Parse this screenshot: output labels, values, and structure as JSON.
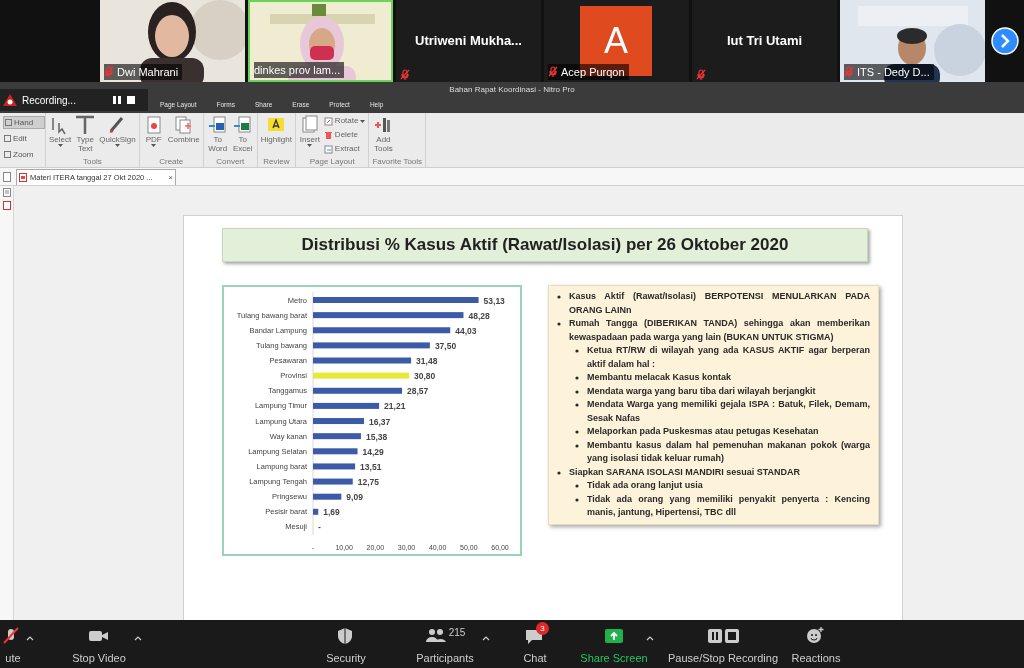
{
  "meeting": {
    "participants": [
      {
        "name": "Dwi Mahrani",
        "kind": "video",
        "muted": true
      },
      {
        "name": "dinkes prov lam...",
        "kind": "video",
        "muted": false
      },
      {
        "name": "Utriweni  Mukha...",
        "kind": "name",
        "muted": true
      },
      {
        "name": "Acep Purqon",
        "kind": "avatar",
        "letter": "A",
        "muted": true
      },
      {
        "name": "Iut Tri Utami",
        "kind": "name",
        "muted": true
      },
      {
        "name": "ITS - Dedy D...",
        "kind": "video",
        "muted": true
      }
    ]
  },
  "app": {
    "title": "Bahan Rapat Koordinasi - Nitro Pro",
    "recording": {
      "label": "Recording..."
    },
    "menu_tabs": [
      "Page Layout",
      "Forms",
      "Share",
      "Erase",
      "Protect",
      "Help"
    ],
    "view_tools": [
      {
        "label": "Hand",
        "selected": true
      },
      {
        "label": "Edit",
        "selected": false
      },
      {
        "label": "Zoom",
        "selected": false
      }
    ],
    "ribbon_groups": [
      {
        "label": "Tools",
        "buttons": [
          {
            "label": "Select",
            "kind": "select",
            "dropdown": true
          },
          {
            "label": "Type Text",
            "kind": "type",
            "dropdown": false
          },
          {
            "label": "QuickSign",
            "kind": "sign",
            "dropdown": true
          }
        ]
      },
      {
        "label": "Create",
        "buttons": [
          {
            "label": "PDF",
            "kind": "pdf",
            "dropdown": true
          },
          {
            "label": "Combine",
            "kind": "combine",
            "dropdown": false
          }
        ]
      },
      {
        "label": "Convert",
        "buttons": [
          {
            "label": "To Word",
            "kind": "word",
            "dropdown": false
          },
          {
            "label": "To Excel",
            "kind": "excel",
            "dropdown": false
          }
        ]
      },
      {
        "label": "Review",
        "buttons": [
          {
            "label": "Highlight",
            "kind": "highlight",
            "dropdown": false
          }
        ]
      },
      {
        "label": "Page Layout",
        "buttons": [
          {
            "label": "Insert",
            "kind": "insert",
            "dropdown": true
          }
        ],
        "small_buttons": [
          {
            "label": "Rotate",
            "kind": "rotate",
            "dropdown": true
          },
          {
            "label": "Delete",
            "kind": "delete",
            "dropdown": false
          },
          {
            "label": "Extract",
            "kind": "extract",
            "dropdown": false
          }
        ]
      },
      {
        "label": "Favorite Tools",
        "buttons": [
          {
            "label": "Add Tools",
            "kind": "add",
            "dropdown": false
          }
        ]
      }
    ],
    "document_tab": {
      "label": "Materi ITERA tanggal 27 Okt 2020 ...",
      "close": "×"
    }
  },
  "slide": {
    "title": "Distribusi % Kasus Aktif (Rawat/Isolasi) per 26 Oktober 2020",
    "chart": {
      "chart_data": {
        "type": "bar",
        "orientation": "horizontal",
        "categories": [
          "Metro",
          "Tulang bawang barat",
          "Bandar Lampung",
          "Tulang bawang",
          "Pesawaran",
          "Provinsi",
          "Tanggamus",
          "Lampung Timur",
          "Lampung Utara",
          "Way kanan",
          "Lampung Selatan",
          "Lampung barat",
          "Lampung Tengah",
          "Pringsewu",
          "Pesisir barat",
          "Mesuji"
        ],
        "series": [
          {
            "color": "#3d5aa8",
            "values": [
              53.13,
              48.28,
              44.03,
              37.5,
              31.48,
              null,
              28.57,
              21.21,
              16.37,
              15.38,
              14.29,
              13.51,
              12.75,
              9.09,
              1.69,
              0
            ]
          },
          {
            "color": "#e8e838",
            "values": [
              null,
              null,
              null,
              null,
              null,
              30.8,
              null,
              null,
              null,
              null,
              null,
              null,
              null,
              null,
              null,
              null
            ]
          }
        ],
        "value_labels": [
          "53,13",
          "48,28",
          "44,03",
          "37,50",
          "31,48",
          "30,80",
          "28,57",
          "21,21",
          "16,37",
          "15,38",
          "14,29",
          "13,51",
          "12,75",
          "9,09",
          "1,69",
          "-"
        ],
        "xlim": [
          0,
          60
        ],
        "xticks": [
          {
            "value": 0,
            "label": "-"
          },
          {
            "value": 10,
            "label": "10,00"
          },
          {
            "value": 20,
            "label": "20,00"
          },
          {
            "value": 30,
            "label": "30,00"
          },
          {
            "value": 40,
            "label": "40,00"
          },
          {
            "value": 50,
            "label": "50,00"
          },
          {
            "value": 60,
            "label": "60,00"
          }
        ]
      }
    },
    "bullets": [
      {
        "text": "Kasus Aktif (Rawat/Isolasi) BERPOTENSI MENULARKAN PADA ORANG LAINn"
      },
      {
        "text": "Rumah Tangga (DIBERIKAN TANDA) sehingga akan memberikan kewaspadaan pada warga yang lain (BUKAN UNTUK STIGMA)",
        "children": [
          {
            "text": "Ketua RT/RW di wilayah yang ada KASUS AKTIF agar berperan aktif dalam hal :"
          },
          {
            "text": "Membantu melacak Kasus kontak"
          },
          {
            "text": "Mendata warga yang baru tiba dari wilayah berjangkit"
          },
          {
            "text": "Mendata Warga yang memiliki gejala ISPA : Batuk, Filek, Demam, Sesak Nafas"
          },
          {
            "text": "Melaporkan pada Puskesmas atau petugas Kesehatan"
          },
          {
            "text": "Membantu kasus dalam hal pemenuhan makanan pokok (warga yang isolasi tidak keluar rumah)"
          }
        ]
      },
      {
        "text": "Siapkan SARANA ISOLASI MANDIRI sesuai STANDAR",
        "children": [
          {
            "text": "Tidak ada orang lanjut usia"
          },
          {
            "text": "Tidak ada orang yang memiliki penyakit penyerta : Kencing manis, jantung, Hipertensi, TBC  dll"
          }
        ]
      }
    ]
  },
  "toolbar": [
    {
      "label": "ute",
      "kind": "mute",
      "caret": true,
      "highlighted": false
    },
    {
      "label": "Stop Video",
      "kind": "video",
      "caret": true,
      "highlighted": false
    },
    {
      "label": "Security",
      "kind": "security",
      "caret": false,
      "highlighted": false
    },
    {
      "label": "Participants",
      "kind": "participants",
      "count": "215",
      "caret": true,
      "highlighted": false
    },
    {
      "label": "Chat",
      "kind": "chat",
      "badge": "3",
      "caret": false,
      "highlighted": false
    },
    {
      "label": "Share Screen",
      "kind": "share",
      "caret": true,
      "highlighted": true
    },
    {
      "label": "Pause/Stop Recording",
      "kind": "recording",
      "caret": false,
      "highlighted": false
    },
    {
      "label": "Reactions",
      "kind": "reactions",
      "caret": false,
      "highlighted": false
    }
  ]
}
